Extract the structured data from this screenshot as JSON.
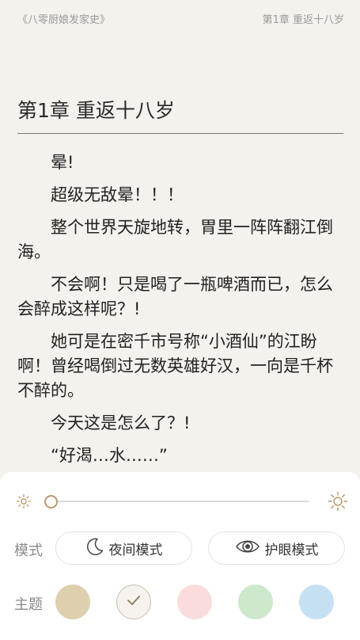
{
  "header": {
    "book_title": "《八零厨娘发家史》",
    "chapter_label": "第1章  重返十八岁"
  },
  "chapter": {
    "title": "第1章 重返十八岁",
    "paragraphs": [
      "晕!",
      "超级无敌晕！！！",
      "整个世界天旋地转，胃里一阵阵翻江倒海。",
      "不会啊！只是喝了一瓶啤酒而已，怎么会醉成这样呢？!",
      "她可是在密千市号称“小酒仙”的江盼啊！曾经喝倒过无数英雄好汉，一向是千杯不醉的。",
      "今天这是怎么了？!",
      "“好渴…水……”"
    ]
  },
  "settings": {
    "brightness_level": 0.0,
    "mode_label": "模式",
    "night_mode_label": "夜间模式",
    "eye_care_label": "护眼模式",
    "theme_label": "主题",
    "themes": [
      {
        "name": "tan",
        "color": "#decfae",
        "selected": false
      },
      {
        "name": "white",
        "color": "#f6f2ed",
        "selected": true
      },
      {
        "name": "pink",
        "color": "#fadcdd",
        "selected": false
      },
      {
        "name": "green",
        "color": "#cde8cd",
        "selected": false
      },
      {
        "name": "blue",
        "color": "#c5dff3",
        "selected": false
      }
    ]
  }
}
